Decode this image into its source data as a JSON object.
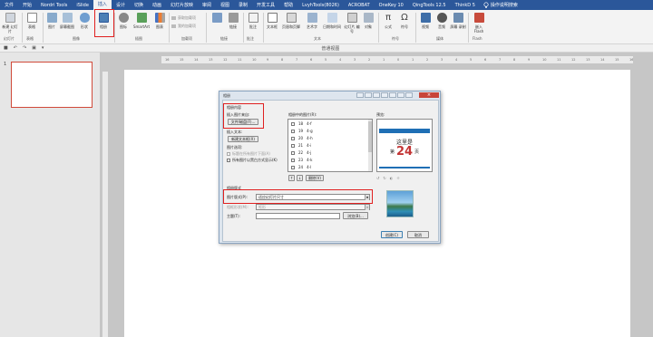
{
  "menu": {
    "file": "文件",
    "home": "开始",
    "nordri": "Nordri Tools",
    "islide": "iSlide",
    "insert": "插入",
    "design": "设计",
    "transitions": "切换",
    "animations": "动画",
    "slideshow": "幻灯片放映",
    "review": "审阅",
    "view": "视图",
    "record": "录制",
    "developer": "开发工具",
    "help": "帮助",
    "lvyh": "LvyhTools(8026)",
    "acrobat": "ACROBAT",
    "onekey": "OneKey 10",
    "qingtools": "QingTools 12.5",
    "thinkd": "ThinkD 5",
    "search": "操作说明搜索"
  },
  "ribbon": {
    "new_slide": "新建\n幻灯片",
    "table": "表格",
    "picture": "图片",
    "screenshot": "屏幕截图",
    "shapes": "形状",
    "album": "相册",
    "icons": "图标",
    "smartart": "SmartArt",
    "chart": "图表",
    "addins": "加载项",
    "link": "链接",
    "comment": "批注",
    "textbox": "文本框",
    "header_footer": "页眉和页脚",
    "wordart": "艺术字",
    "date_time": "日期和时间",
    "slide_number": "幻灯片\n编号",
    "object": "对象",
    "equation": "公式",
    "symbol": "符号",
    "video": "视频",
    "audio": "音频",
    "screen_recording": "屏幕\n录制",
    "flash": "嵌入\nFlash",
    "store": "获取加载项",
    "my_addins": "我的加载项",
    "groups": {
      "slides": "幻灯片",
      "tables": "表格",
      "images": "图像",
      "illustrations": "插图",
      "addins": "加载项",
      "links": "链接",
      "comments": "批注",
      "text": "文本",
      "symbols": "符号",
      "media": "媒体",
      "flash": "Flash"
    }
  },
  "qat": {
    "view_dropdown": "普通视图"
  },
  "slide_panel": {
    "number": "1"
  },
  "ruler": {
    "ticks": [
      "16",
      "15",
      "14",
      "13",
      "12",
      "11",
      "10",
      "9",
      "8",
      "7",
      "6",
      "5",
      "4",
      "3",
      "2",
      "1",
      "0",
      "1",
      "2",
      "3",
      "4",
      "5",
      "6",
      "7",
      "8",
      "9",
      "10",
      "11",
      "12",
      "13",
      "14",
      "15",
      "16"
    ]
  },
  "dialog": {
    "title": "相册",
    "source_label": "相册内容",
    "insert_from": "插入图片来自:",
    "file_disk_button": "文件/磁盘(F)...",
    "insert_text_label": "插入文本:",
    "new_textbox_button": "新建文本框(X)",
    "pic_options_label": "图片选项:",
    "caption_option": "标题在所有图片下面(A)",
    "bw_option": "所有图片以黑白方式显示(K)",
    "list_label": "相册中的图片(R):",
    "preview_label": "预览:",
    "pictures": [
      {
        "num": "18",
        "name": "4-f"
      },
      {
        "num": "19",
        "name": "4-g"
      },
      {
        "num": "20",
        "name": "4-h"
      },
      {
        "num": "21",
        "name": "4-i"
      },
      {
        "num": "22",
        "name": "4-j"
      },
      {
        "num": "23",
        "name": "4-k"
      },
      {
        "num": "24",
        "name": "4-l"
      }
    ],
    "up_button": "↑",
    "down_button": "↓",
    "remove_button": "删除(V)",
    "layout_label": "相册版式",
    "pic_layout_label": "图片版式(P):",
    "pic_layout_value": "适应幻灯片尺寸",
    "frame_label": "相框形状(M):",
    "frame_value": "矩形",
    "theme_label": "主题(T):",
    "browse_button": "浏览(B)...",
    "create_button": "创建(C)",
    "cancel_button": "取消",
    "preview_title": "这里是",
    "preview_prefix": "第",
    "preview_number": "24",
    "preview_suffix": "页"
  },
  "colors": {
    "accent": "#2b579a",
    "highlight": "#e02020",
    "preview_number": "#c33535"
  }
}
